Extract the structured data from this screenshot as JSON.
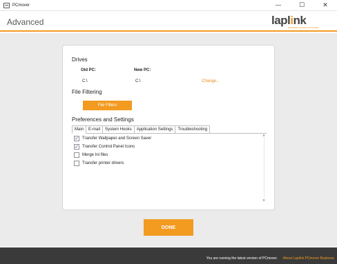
{
  "window": {
    "title": "PCmover",
    "controls": {
      "minimize": "—",
      "maximize": "☐",
      "close": "✕"
    }
  },
  "header": {
    "page_title": "Advanced",
    "logo": {
      "brand_pre": "lapl",
      "brand_i": "i",
      "brand_post": "nk",
      "tagline": "BUSINESS GRADE SOFTWARE"
    }
  },
  "drives": {
    "title": "Drives",
    "old_pc_label": "Old PC:",
    "new_pc_label": "New PC:",
    "old_pc_value": "C:\\",
    "new_pc_value": "C:\\",
    "change_link": "Change..."
  },
  "file_filtering": {
    "title": "File Filtering",
    "button": "File Filters"
  },
  "preferences": {
    "title": "Preferences and Settings",
    "tabs": [
      {
        "label": "Main",
        "active": true
      },
      {
        "label": "E-mail",
        "active": false
      },
      {
        "label": "System Hooks",
        "active": false
      },
      {
        "label": "Application Settings",
        "active": false
      },
      {
        "label": "Troubleshooting",
        "active": false
      }
    ],
    "options": [
      {
        "label": "Transfer Wallpaper and Screen Saver",
        "checked": true,
        "mark": "✓"
      },
      {
        "label": "Transfer Control Panel Icons",
        "checked": true,
        "mark": "✓"
      },
      {
        "label": "Merge Ini files",
        "checked": false,
        "mark": ""
      },
      {
        "label": "Transfer printer drivers",
        "checked": false,
        "mark": ""
      }
    ]
  },
  "scrollbar": {
    "up": "▲",
    "down": "▼"
  },
  "actions": {
    "done": "DONE"
  },
  "footer": {
    "status": "You are running the latest version of PCmover.",
    "link": "About Laplink PCmover Business"
  },
  "colors": {
    "accent": "#f39a21",
    "footer_bg": "#3a3a3a",
    "content_bg": "#ebebeb"
  }
}
